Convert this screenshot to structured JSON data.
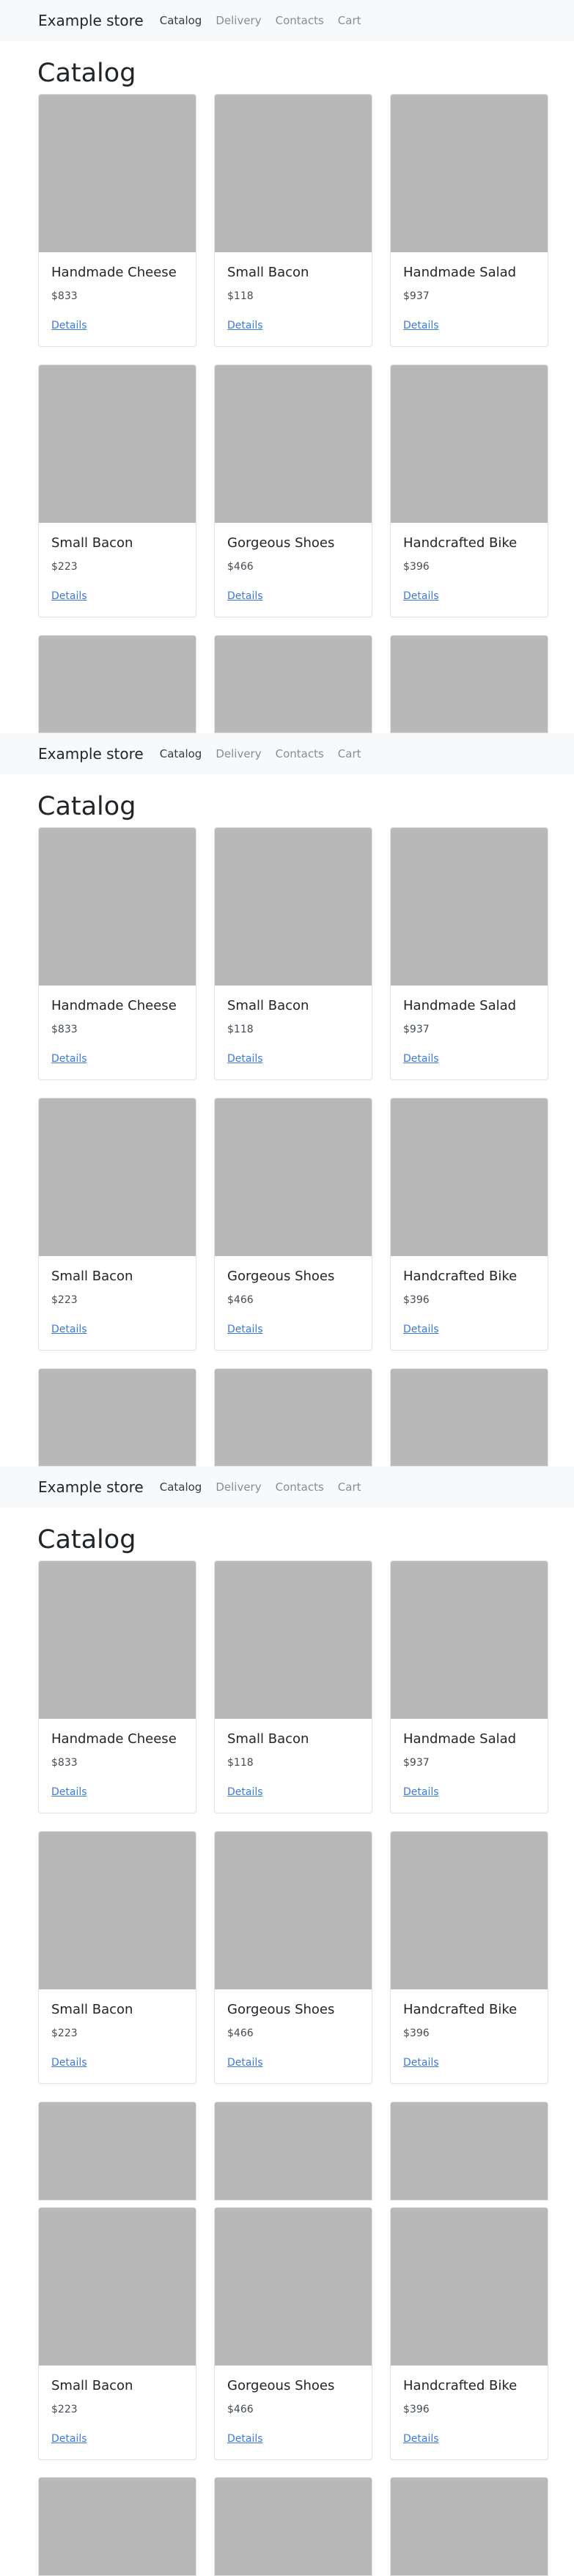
{
  "brand": "Example store",
  "nav": [
    {
      "label": "Catalog",
      "active": true
    },
    {
      "label": "Delivery",
      "active": false
    },
    {
      "label": "Contacts",
      "active": false
    },
    {
      "label": "Cart",
      "active": false
    }
  ],
  "page_title": "Catalog",
  "products": [
    {
      "name": "Handmade Cheese",
      "price": "$833",
      "link": "Details"
    },
    {
      "name": "Small Bacon",
      "price": "$118",
      "link": "Details"
    },
    {
      "name": "Handmade Salad",
      "price": "$937",
      "link": "Details"
    },
    {
      "name": "Small Bacon",
      "price": "$223",
      "link": "Details"
    },
    {
      "name": "Gorgeous Shoes",
      "price": "$466",
      "link": "Details"
    },
    {
      "name": "Handcrafted Bike",
      "price": "$396",
      "link": "Details"
    }
  ],
  "repeat_products": [
    {
      "name": "Small Bacon",
      "price": "$223",
      "link": "Details"
    },
    {
      "name": "Gorgeous Shoes",
      "price": "$466",
      "link": "Details"
    },
    {
      "name": "Handcrafted Bike",
      "price": "$396",
      "link": "Details"
    }
  ],
  "colors": {
    "navbar_bg": "#f8f9fa",
    "placeholder": "#b8b8b8",
    "link": "#3d7ae0"
  }
}
